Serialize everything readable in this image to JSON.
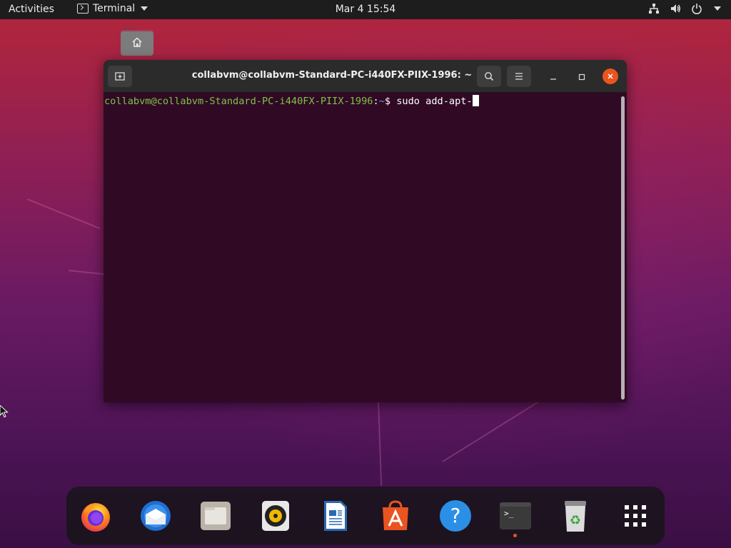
{
  "topbar": {
    "activities": "Activities",
    "app_name": "Terminal",
    "clock": "Mar 4  15:54"
  },
  "terminal": {
    "title": "collabvm@collabvm-Standard-PC-i440FX-PIIX-1996: ~",
    "prompt_user": "collabvm@collabvm-Standard-PC-i440FX-PIIX-1996",
    "prompt_sep": ":",
    "prompt_path": "~",
    "prompt_symbol": "$ ",
    "command": "sudo add-apt-"
  },
  "dock": {
    "items": [
      {
        "name": "firefox",
        "icon": "firefox-icon"
      },
      {
        "name": "thunderbird",
        "icon": "thunderbird-icon"
      },
      {
        "name": "files",
        "icon": "files-icon"
      },
      {
        "name": "rhythmbox",
        "icon": "rhythmbox-icon"
      },
      {
        "name": "libreoffice-writer",
        "icon": "writer-icon"
      },
      {
        "name": "ubuntu-software",
        "icon": "software-icon"
      },
      {
        "name": "help",
        "icon": "help-icon",
        "glyph": "?"
      },
      {
        "name": "terminal",
        "icon": "terminal-icon",
        "glyph": ">_",
        "running": true
      },
      {
        "name": "trash",
        "icon": "trash-icon",
        "glyph": "♻"
      },
      {
        "name": "show-applications",
        "icon": "grid-icon"
      }
    ]
  },
  "colors": {
    "accent": "#e95420",
    "terminal_bg": "#300a24",
    "prompt_user": "#7ec24a",
    "prompt_path": "#6f9ad6"
  }
}
